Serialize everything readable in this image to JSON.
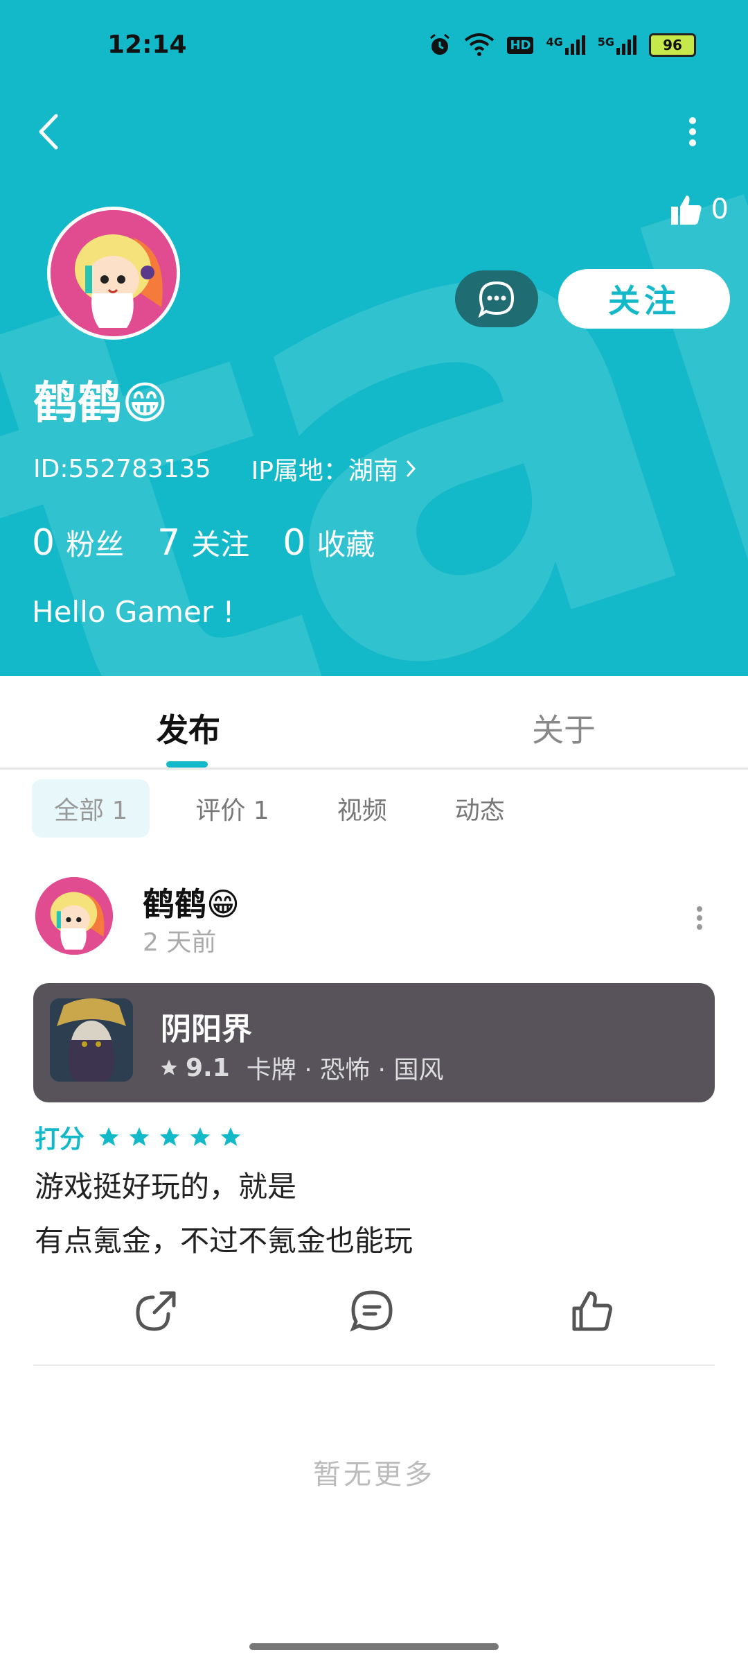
{
  "status_bar": {
    "time": "12:14",
    "battery": "96",
    "network_labels": [
      "HD",
      "4G",
      "5G"
    ]
  },
  "profile": {
    "username": "鹤鹤😁",
    "id_text": "ID:552783135",
    "ip_location": "IP属地：湖南",
    "likes": "0",
    "follow_button": "关注",
    "bio": "Hello Gamer !",
    "stats": [
      {
        "value": "0",
        "label": "粉丝"
      },
      {
        "value": "7",
        "label": "关注"
      },
      {
        "value": "0",
        "label": "收藏"
      }
    ]
  },
  "tabs": [
    {
      "label": "发布",
      "active": true
    },
    {
      "label": "关于",
      "active": false
    }
  ],
  "filter_chips": [
    {
      "label": "全部 1",
      "active": true
    },
    {
      "label": "评价 1",
      "active": false
    },
    {
      "label": "视频",
      "active": false
    },
    {
      "label": "动态",
      "active": false
    }
  ],
  "post": {
    "author": "鹤鹤😁",
    "time_ago": "2 天前",
    "game": {
      "title": "阴阳界",
      "score": "9.1",
      "tags": "卡牌 · 恐怖 · 国风"
    },
    "rating_label": "打分",
    "rating_stars": 5,
    "text_line1": "游戏挺好玩的，就是",
    "text_line2": "有点氪金，不过不氪金也能玩"
  },
  "footer": {
    "no_more": "暂无更多"
  },
  "colors": {
    "accent": "#13b9c9",
    "game_card": "#58535a"
  }
}
